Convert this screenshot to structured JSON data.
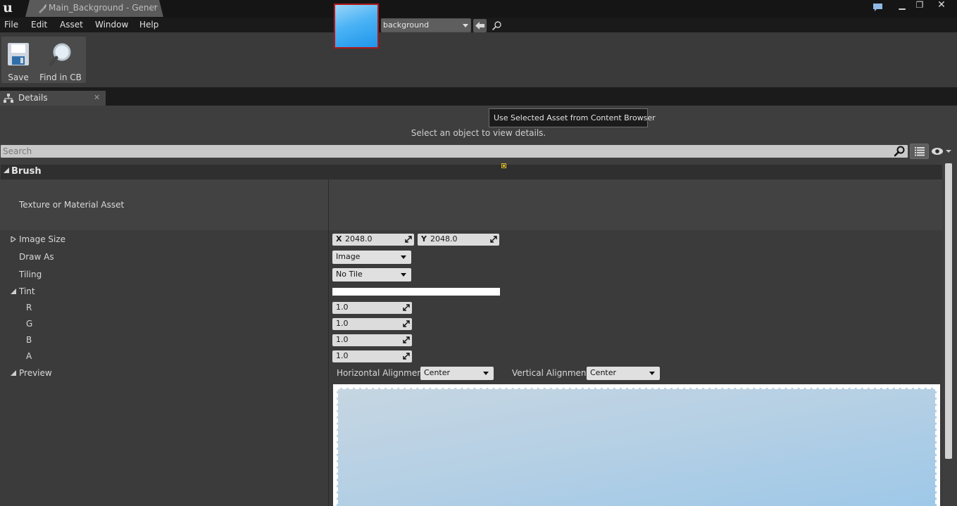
{
  "window": {
    "tab_title": "Main_Background - Gener",
    "logo_text": "u",
    "minimize": "▁",
    "maximize": "❐",
    "close": "✕"
  },
  "menu": [
    "File",
    "Edit",
    "Asset",
    "Window",
    "Help"
  ],
  "toolbar": {
    "save_label": "Save",
    "find_label": "Find in CB"
  },
  "details_tab": {
    "label": "Details"
  },
  "details": {
    "select_message": "Select an object to view details.",
    "search_placeholder": "Search",
    "category": "Brush",
    "texture_label": "Texture or Material Asset",
    "asset_value": "background",
    "tooltip": "Use Selected Asset from Content Browser",
    "image_size_label": "Image Size",
    "image_size_x_axis": "X",
    "image_size_x": "2048.0",
    "image_size_y_axis": "Y",
    "image_size_y": "2048.0",
    "draw_as_label": "Draw As",
    "draw_as_value": "Image",
    "tiling_label": "Tiling",
    "tiling_value": "No Tile",
    "tint_label": "Tint",
    "tint_color": "#ffffff",
    "tint": [
      {
        "label": "R",
        "value": "1.0"
      },
      {
        "label": "G",
        "value": "1.0"
      },
      {
        "label": "B",
        "value": "1.0"
      },
      {
        "label": "A",
        "value": "1.0"
      }
    ],
    "preview_label": "Preview",
    "horizontal_alignment_label": "Horizontal Alignment",
    "horizontal_alignment_value": "Center",
    "vertical_alignment_label": "Vertical Alignment",
    "vertical_alignment_value": "Center"
  },
  "icons": {
    "logo": "unreal-logo-icon",
    "document": "brush-asset-icon",
    "chat": "chat-bubble-icon",
    "save": "save-icon",
    "find": "magnifier-icon",
    "details": "hierarchy-icon",
    "search": "search-icon",
    "view_options": "list-view-icon",
    "eye": "eye-icon"
  },
  "colors": {
    "thumbnail_border": "#b01818",
    "tint": "#ffffff"
  }
}
